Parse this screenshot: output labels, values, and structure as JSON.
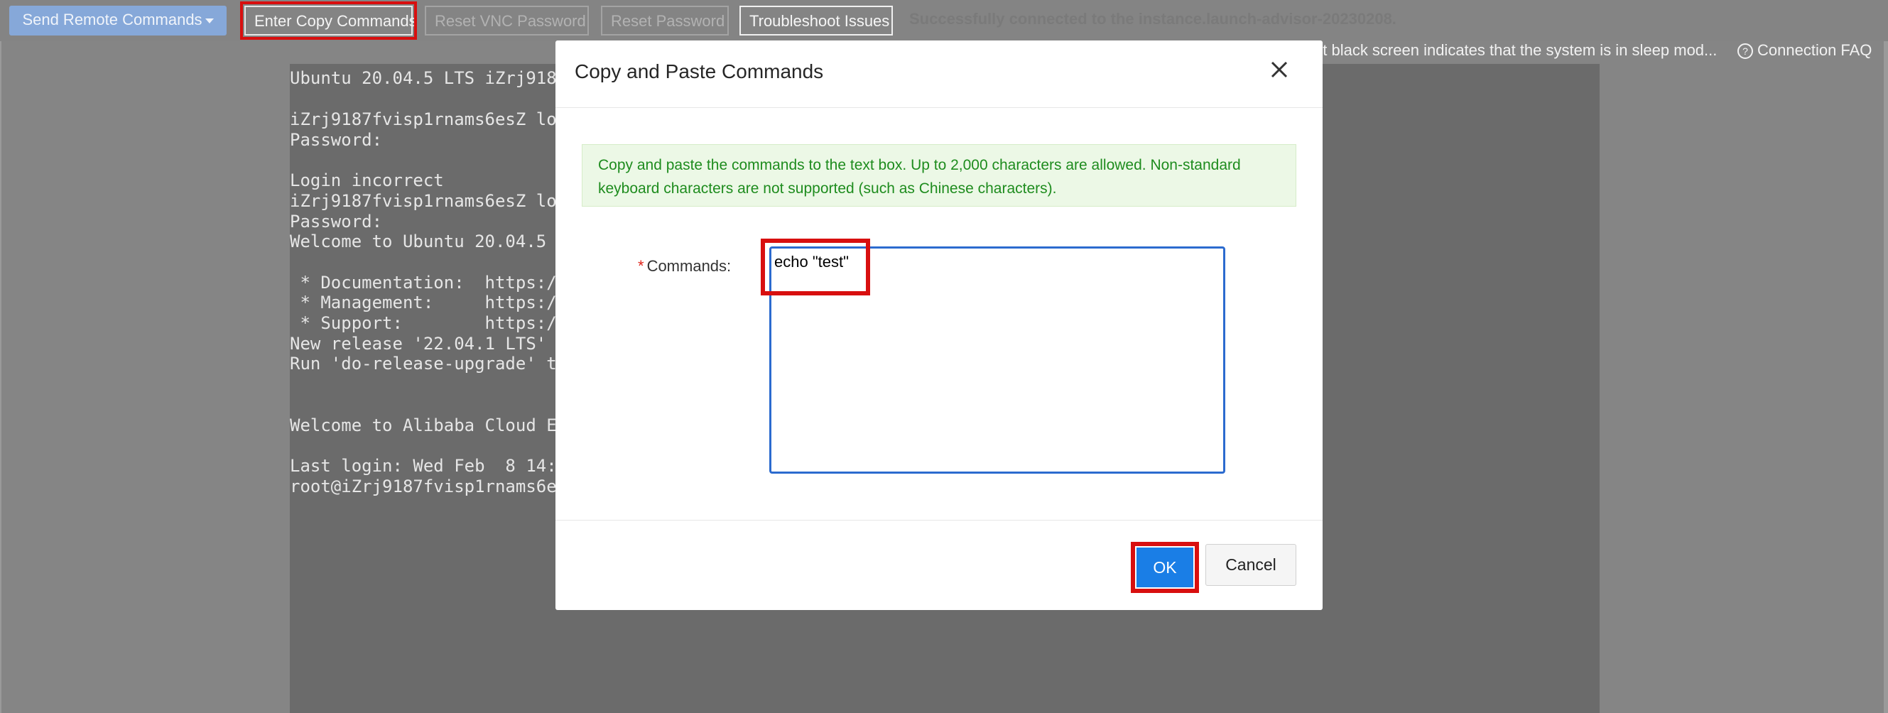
{
  "toolbar": {
    "send_remote": "Send Remote Commands",
    "enter_copy": "Enter Copy Commands",
    "reset_vnc": "Reset VNC Password",
    "reset_password": "Reset Password",
    "troubleshoot": "Troubleshoot Issues",
    "status": "Successfully connected to the instance.launch-advisor-20230208.",
    "notice": "nt black screen indicates that the system is in sleep mod...",
    "faq": "Connection FAQ"
  },
  "terminal": {
    "lines": [
      "Ubuntu 20.04.5 LTS iZrj918",
      "iZrj9187fvisp1rnams6esZ lo",
      "Password:",
      "Login incorrect",
      "iZrj9187fvisp1rnams6esZ lo",
      "Password:",
      "Welcome to Ubuntu 20.04.5",
      " * Documentation:  https:/",
      " * Management:     https:/",
      " * Support:        https:/",
      "New release '22.04.1 LTS'",
      "Run 'do-release-upgrade' t",
      "Welcome to Alibaba Cloud E",
      "Last login: Wed Feb  8 14:",
      "root@iZrj9187fvisp1rnams6e"
    ]
  },
  "modal": {
    "title": "Copy and Paste Commands",
    "alert": "Copy and paste the commands to the text box. Up to 2,000 characters are allowed. Non-standard keyboard characters are not supported (such as Chinese characters).",
    "commands_label": "Commands:",
    "commands_value": "echo \"test\"",
    "ok": "OK",
    "cancel": "Cancel"
  },
  "colors": {
    "accent": "#1a7ee6",
    "highlight": "#d80f0f",
    "alert_text": "#1e8c1e"
  }
}
